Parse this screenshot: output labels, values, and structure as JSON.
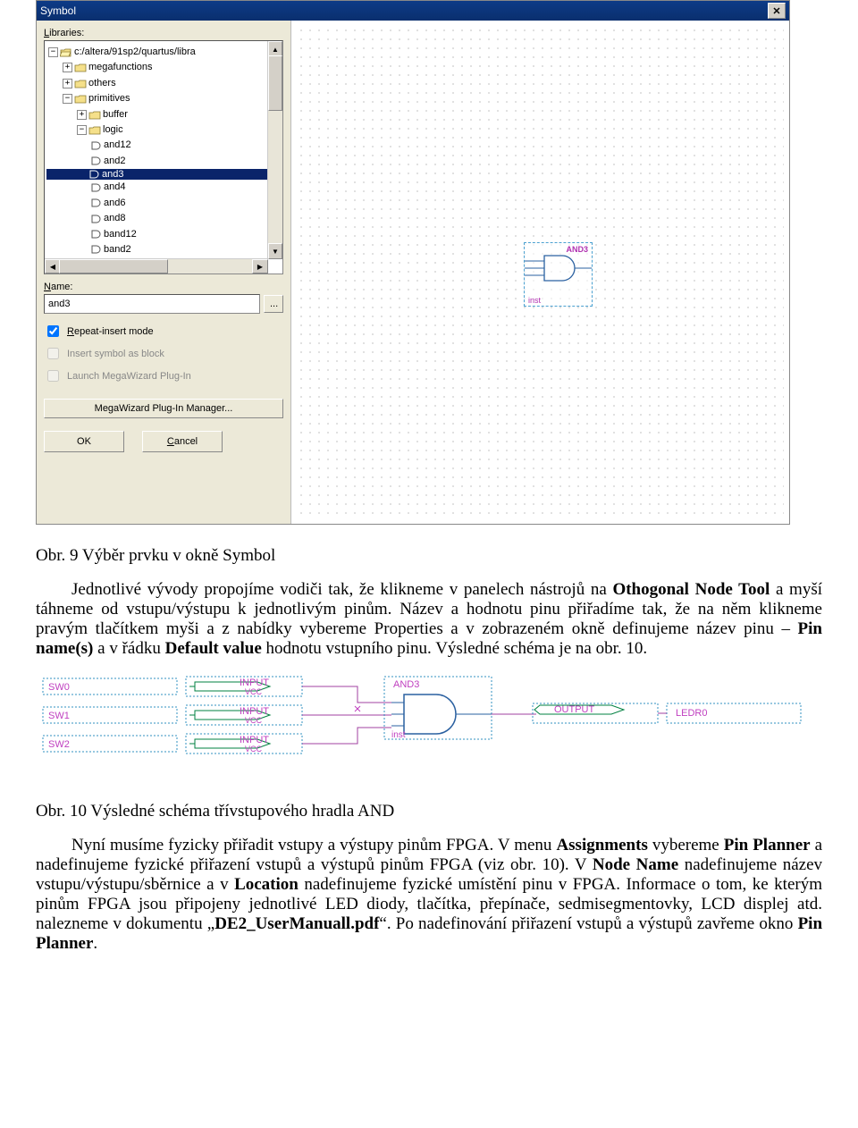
{
  "dialog": {
    "title": "Symbol",
    "libraries_label": "Libraries:",
    "tree": {
      "root": "c:/altera/91sp2/quartus/libra",
      "folders": [
        "megafunctions",
        "others",
        "primitives"
      ],
      "subfolders": [
        "buffer",
        "logic"
      ],
      "items": [
        "and12",
        "and2",
        "and3",
        "and4",
        "and6",
        "and8",
        "band12",
        "band2"
      ],
      "selected": "and3"
    },
    "name_label": "Name:",
    "name_value": "and3",
    "browse_btn": "...",
    "chk1": "Repeat-insert mode",
    "chk2": "Insert symbol as block",
    "chk3": "Launch MegaWizard Plug-In",
    "mega_btn": "MegaWizard Plug-In Manager...",
    "ok": "OK",
    "cancel": "Cancel"
  },
  "preview": {
    "label": "AND3",
    "inst": "inst"
  },
  "caption1": "Obr. 9 Výběr prvku v okně Symbol",
  "para1a": "Jednotlivé vývody propojíme vodiči tak, že klikneme v panelech nástrojů na ",
  "para1b": "Othogonal Node Tool",
  "para1c": " a myší táhneme od vstupu/výstupu k jednotlivým pinům. Název a hodnotu pinu přiřadíme tak, že na něm klikneme pravým tlačítkem myši a z nabídky vybereme Properties a v zobrazeném okně definujeme název pinu – ",
  "para1d": "Pin name(s)",
  "para1e": " a v řádku ",
  "para1f": "Default value",
  "para1g": " hodnotu vstupního pinu. Výsledné schéma je na obr. 10.",
  "schem": {
    "sw0": "SW0",
    "sw1": "SW1",
    "sw2": "SW2",
    "input": "INPUT",
    "vcc": "VCC",
    "and3": "AND3",
    "inst": "inst",
    "output": "OUTPUT",
    "ledr0": "LEDR0"
  },
  "caption2": "Obr. 10 Výsledné schéma třívstupového hradla AND",
  "para2a": "Nyní musíme fyzicky přiřadit vstupy a výstupy pinům FPGA. V menu ",
  "para2b": "Assignments",
  "para2c": " vybereme ",
  "para2d": "Pin Planner",
  "para2e": " a nadefinujeme fyzické přiřazení vstupů a výstupů pinům FPGA (viz obr. 10). V ",
  "para2f": "Node Name",
  "para2g": " nadefinujeme název vstupu/výstupu/sběrnice a v ",
  "para2h": "Location",
  "para2i": " nadefinujeme fyzické umístění pinu v FPGA. Informace o tom, ke kterým pinům FPGA jsou připojeny jednotlivé LED diody, tlačítka, přepínače, sedmisegmentovky, LCD displej atd. nalezneme v dokumentu „",
  "para2j": "DE2_UserManuall.pdf",
  "para2k": "“. Po nadefinování přiřazení vstupů a výstupů zavřeme okno ",
  "para2l": "Pin Planner",
  "para2m": "."
}
